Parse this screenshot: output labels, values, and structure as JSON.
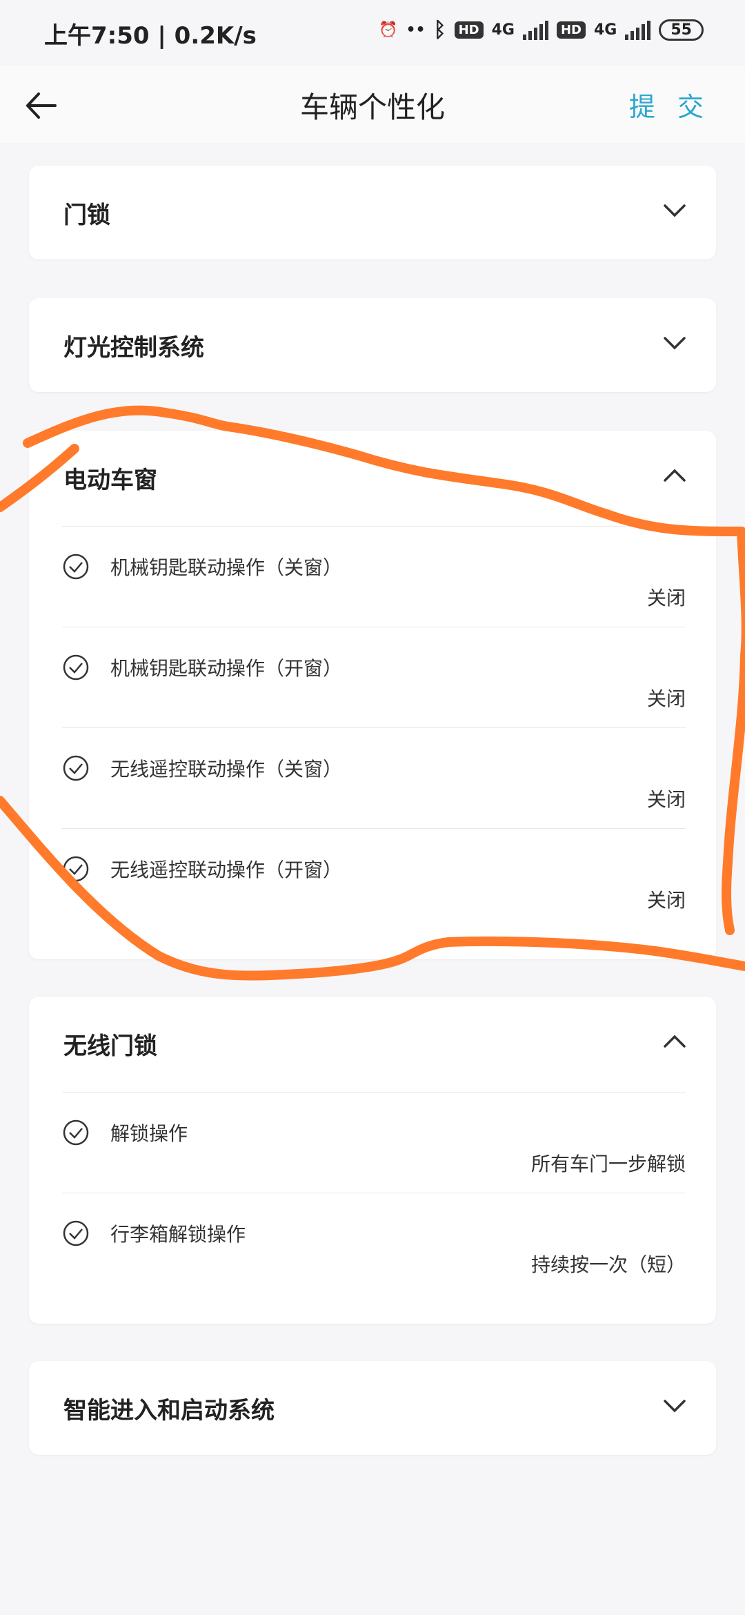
{
  "status": {
    "time_speed": "上午7:50 | 0.2K/s",
    "hd1": "HD",
    "net1": "4G",
    "hd2": "HD",
    "net2": "4G",
    "battery": "55"
  },
  "header": {
    "title": "车辆个性化",
    "submit_label": "提 交"
  },
  "sections": [
    {
      "title": "门锁",
      "expanded": false,
      "items": []
    },
    {
      "title": "灯光控制系统",
      "expanded": false,
      "items": []
    },
    {
      "title": "电动车窗",
      "expanded": true,
      "items": [
        {
          "label": "机械钥匙联动操作（关窗）",
          "value": "关闭"
        },
        {
          "label": "机械钥匙联动操作（开窗）",
          "value": "关闭"
        },
        {
          "label": "无线遥控联动操作（关窗）",
          "value": "关闭"
        },
        {
          "label": "无线遥控联动操作（开窗）",
          "value": "关闭"
        }
      ]
    },
    {
      "title": "无线门锁",
      "expanded": true,
      "items": [
        {
          "label": "解锁操作",
          "value": "所有车门一步解锁"
        },
        {
          "label": "行李箱解锁操作",
          "value": "持续按一次（短）"
        }
      ]
    },
    {
      "title": "智能进入和启动系统",
      "expanded": false,
      "items": []
    }
  ],
  "colors": {
    "accent": "#2aa6cf",
    "annotation": "#ff7a2a"
  }
}
